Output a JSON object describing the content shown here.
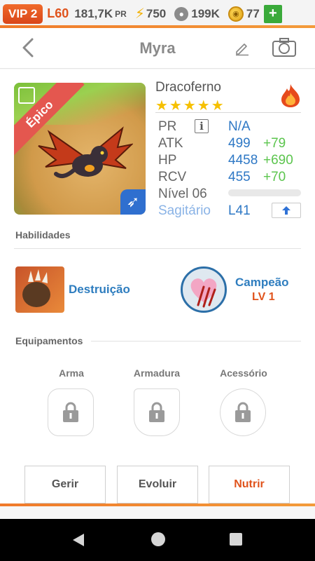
{
  "topbar": {
    "vip": "VIP 2",
    "level": "L60",
    "power": "181,7K",
    "power_unit": "PR",
    "energy": "750",
    "food": "199K",
    "coins": "77",
    "plus": "+"
  },
  "header": {
    "title": "Myra"
  },
  "creature": {
    "rarity": "Épico",
    "species": "Dracoferno",
    "stars": "★★★★★",
    "stats": [
      {
        "label": "PR",
        "value": "N/A",
        "plus": ""
      },
      {
        "label": "ATK",
        "value": "499",
        "plus": "+79"
      },
      {
        "label": "HP",
        "value": "4458",
        "plus": "+690"
      },
      {
        "label": "RCV",
        "value": "455",
        "plus": "+70"
      }
    ],
    "level_label": "Nível 06",
    "level_progress": 0,
    "sign": "Sagitário",
    "sign_level": "L41",
    "info_glyph": "i"
  },
  "skills": {
    "heading": "Habilidades",
    "items": [
      {
        "name": "Destruição",
        "level": ""
      },
      {
        "name": "Campeão",
        "level": "LV 1"
      }
    ]
  },
  "equipment": {
    "heading": "Equipamentos",
    "slots": [
      {
        "label": "Arma"
      },
      {
        "label": "Armadura"
      },
      {
        "label": "Acessório"
      }
    ]
  },
  "actions": {
    "manage": "Gerir",
    "evolve": "Evoluir",
    "feed": "Nutrir"
  },
  "colors": {
    "accent_orange": "#e0531c",
    "stat_blue": "#2e78c5",
    "stat_green": "#5cc54e",
    "skill_blue": "#2e7dbf"
  },
  "icons": {
    "back": "chevron-left-icon",
    "edit": "pencil-icon",
    "camera": "camera-icon",
    "element": "fire-icon",
    "lock": "lock-icon"
  }
}
